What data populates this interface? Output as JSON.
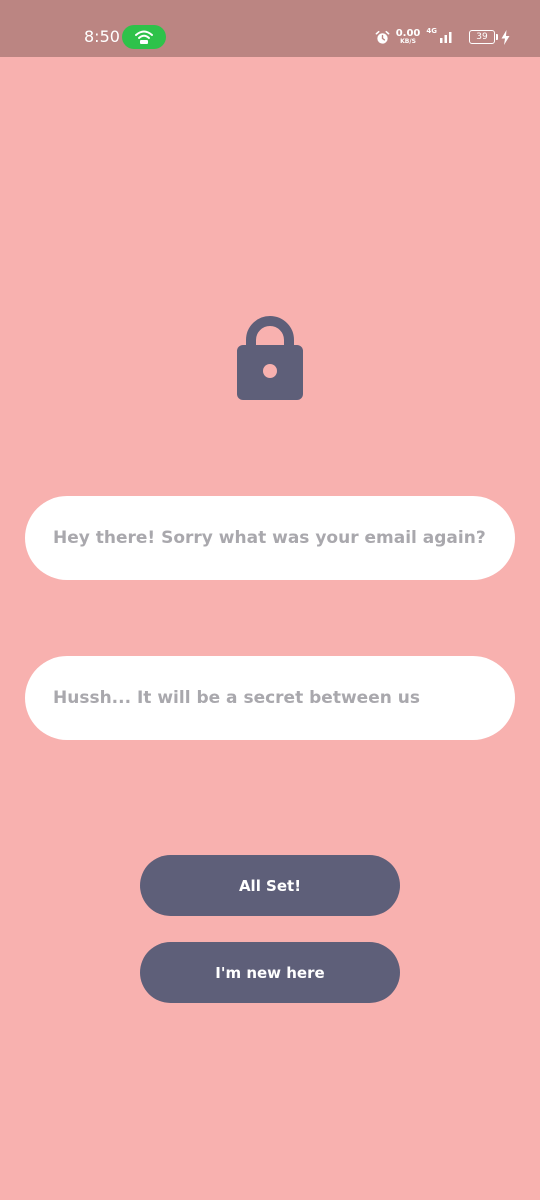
{
  "status_bar": {
    "time": "8:50",
    "net_speed_value": "0.00",
    "net_speed_unit": "KB/S",
    "network_type": "4G",
    "battery_level": "39",
    "icons": [
      "hotspot-icon",
      "alarm-icon",
      "signal-icon",
      "battery-icon",
      "charging-icon"
    ]
  },
  "lock": {
    "icon": "lock-icon"
  },
  "form": {
    "email_placeholder": "Hey there! Sorry what was your email again?",
    "email_value": "",
    "password_placeholder": "Hussh... It will be a secret between us",
    "password_value": ""
  },
  "buttons": {
    "login_label": "All Set!",
    "register_label": "I'm new here"
  },
  "colors": {
    "background": "#f8b1af",
    "status_bar": "#bb8582",
    "accent": "#5e5f79",
    "field": "#ffffff",
    "placeholder": "#a9a8ad",
    "hotspot": "#2ec24a"
  }
}
